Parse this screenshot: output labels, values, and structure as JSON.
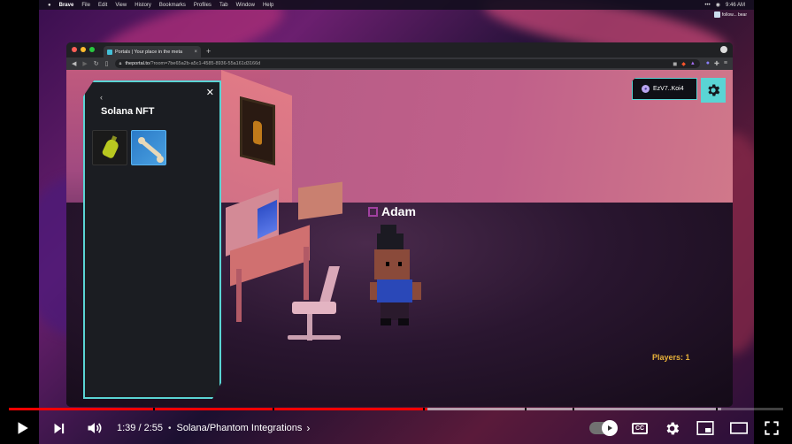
{
  "menubar": {
    "app": "Brave",
    "items": [
      "File",
      "Edit",
      "View",
      "History",
      "Bookmarks",
      "Profiles",
      "Tab",
      "Window",
      "Help"
    ],
    "clock": "9:46 AM"
  },
  "desktop": {
    "file_label": "follow... bear"
  },
  "browser": {
    "tab_title": "Portals | Your place in the meta",
    "url_host": "theportal.to",
    "url_path": "/?room=7be65a2b-a5c1-4585-8936-55a161d3166d"
  },
  "game": {
    "nft_panel": {
      "title": "Solana NFT",
      "back": "‹",
      "close": "✕",
      "items": [
        "potion",
        "bone"
      ]
    },
    "player_name": "Adam",
    "wallet": {
      "label": "EzV7..Koi4"
    },
    "players_count": "Players: 1"
  },
  "video": {
    "time": "1:39 / 2:55",
    "separator": "•",
    "chapter": "Solana/Phantom Integrations",
    "chevron": "›",
    "progress_played": 0.54,
    "progress_buffered": 0.92
  },
  "colors": {
    "accent": "#5ad4d4",
    "players": "#e9b23a",
    "progress": "#ff0000"
  }
}
